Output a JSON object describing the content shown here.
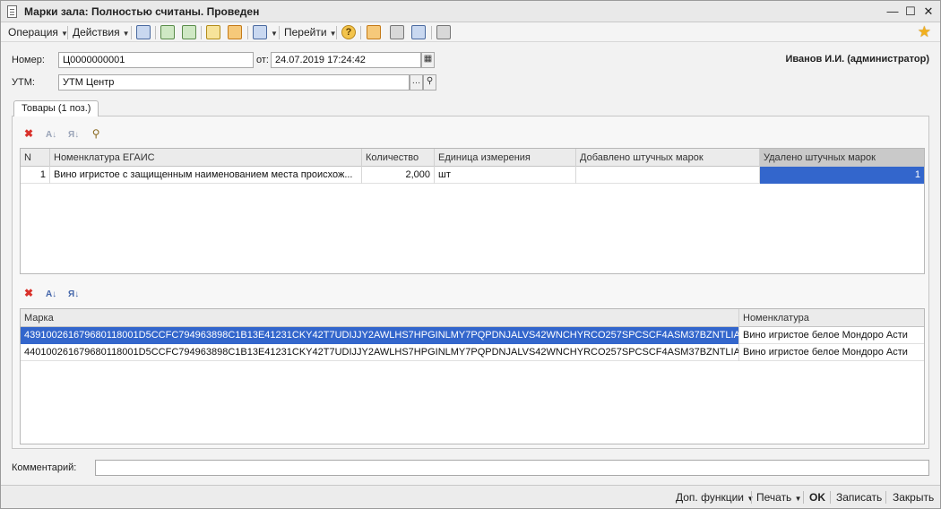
{
  "window": {
    "title": "Марки зала: Полностью считаны. Проведен"
  },
  "toolbar": {
    "operation": "Операция",
    "actions": "Действия",
    "goto": "Перейти",
    "help_glyph": "?"
  },
  "header": {
    "number_label": "Номер:",
    "number_value": "Ц0000000001",
    "date_label": "от:",
    "date_value": "24.07.2019 17:24:42",
    "utm_label": "УТМ:",
    "utm_value": "УТМ Центр",
    "user": "Иванов И.И. (администратор)"
  },
  "tab": {
    "label": "Товары (1 поз.)"
  },
  "goods_table": {
    "columns": [
      "N",
      "Номенклатура ЕГАИС",
      "Количество",
      "Единица измерения",
      "Добавлено штучных марок",
      "Удалено штучных марок"
    ],
    "rows": [
      {
        "n": "1",
        "name": "Вино игристое с защищенным наименованием места происхож...",
        "qty": "2,000",
        "unit": "шт",
        "added": "",
        "removed": "1"
      }
    ]
  },
  "marks_table": {
    "columns": [
      "Марка",
      "Номенклатура"
    ],
    "rows": [
      {
        "mark": "439100261679680118001D5CCFC794963898C1B13E41231CKY42T7UDIJJY2AWLHS7HPGINLMY7PQPDNJALVS42WNCHYRCO257SPCSCF4ASM37BZNTLIAS...",
        "name": "Вино игристое белое Мондоро Асти"
      },
      {
        "mark": "440100261679680118001D5CCFC794963898C1B13E41231CKY42T7UDIJJY2AWLHS7HPGINLMY7PQPDNJALVS42WNCHYRCO257SPCSCF4ASM37BZNTLIAS...",
        "name": "Вино игристое белое Мондоро Асти"
      }
    ]
  },
  "comment": {
    "label": "Комментарий:",
    "value": ""
  },
  "footer": {
    "extra": "Доп. функции",
    "print": "Печать",
    "ok": "OK",
    "save": "Записать",
    "close": "Закрыть"
  },
  "colors": {
    "selection": "#3366cc",
    "accent_star": "#f2b01e",
    "delete_red": "#d9312b"
  }
}
